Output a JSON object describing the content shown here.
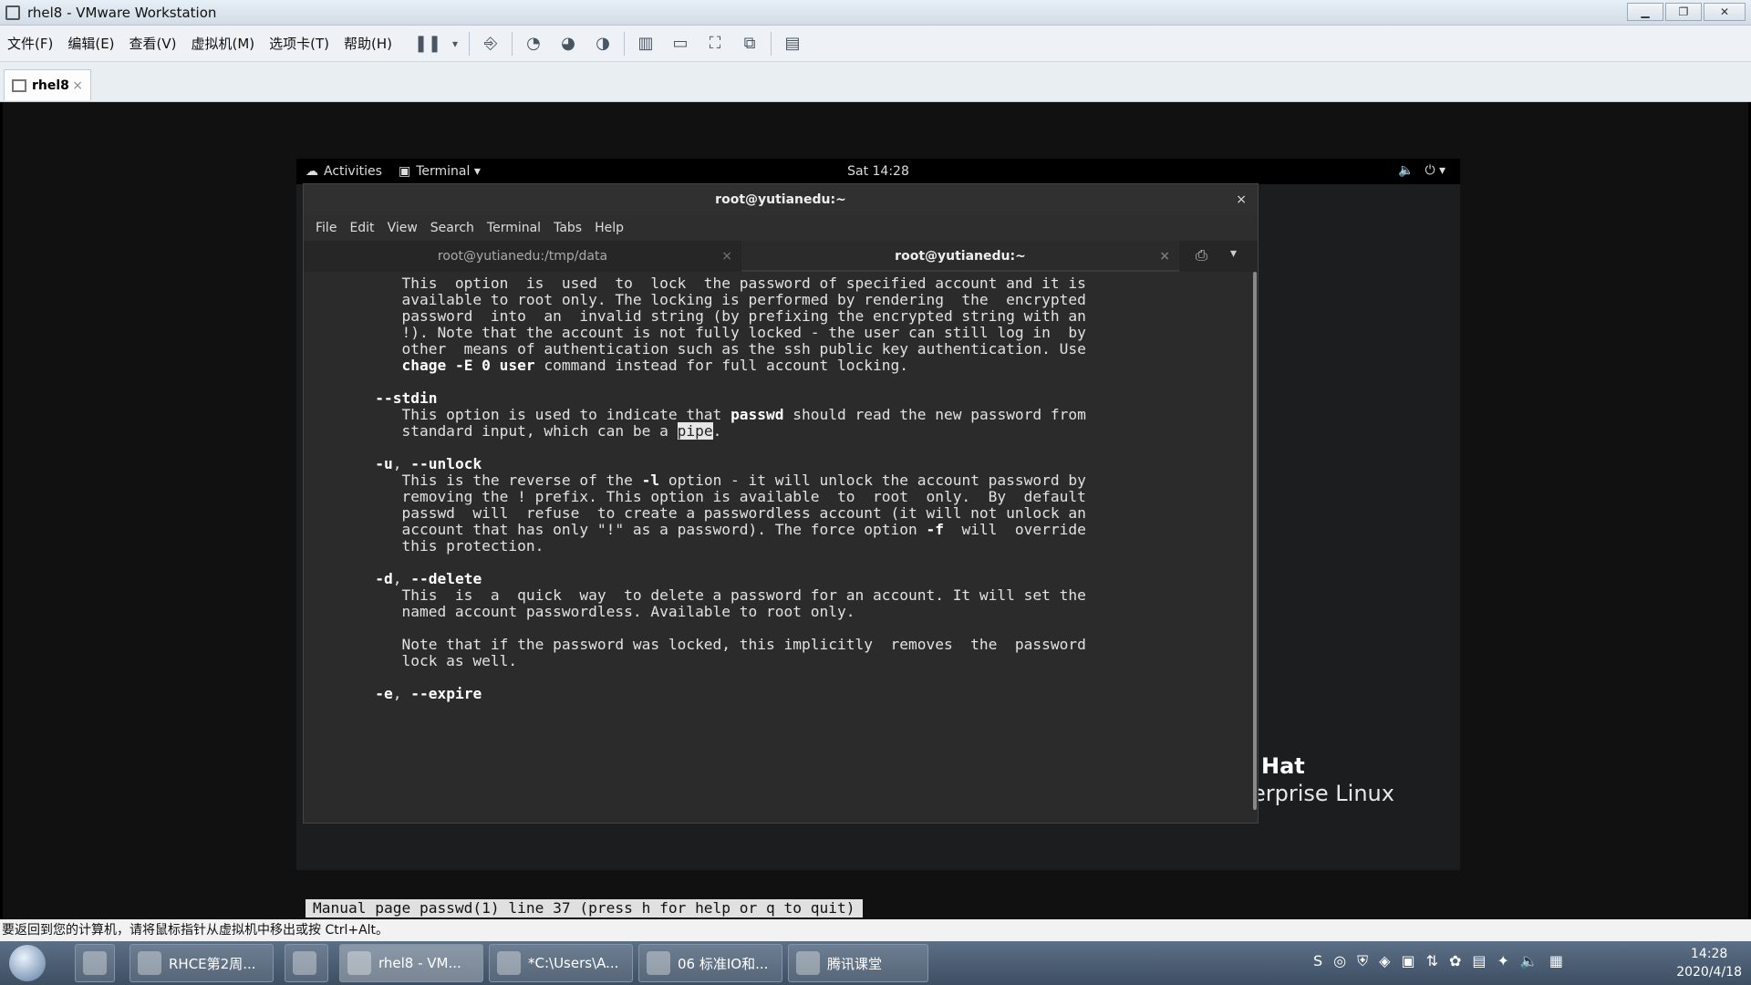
{
  "window": {
    "title": "rhel8 - VMware Workstation"
  },
  "menu": {
    "items": [
      "文件(F)",
      "编辑(E)",
      "查看(V)",
      "虚拟机(M)",
      "选项卡(T)",
      "帮助(H)"
    ]
  },
  "library_tab": {
    "label": "rhel8",
    "close": "×"
  },
  "gnome": {
    "activities": "Activities",
    "app_menu": "Terminal ▾",
    "clock": "Sat 14:28",
    "volume_icon": "🔈",
    "power_icon": "⏻ ▾"
  },
  "terminal": {
    "title": "root@yutianedu:~",
    "close": "×",
    "menu": [
      "File",
      "Edit",
      "View",
      "Search",
      "Terminal",
      "Tabs",
      "Help"
    ],
    "tabs": [
      {
        "label": "root@yutianedu:/tmp/data",
        "close": "×"
      },
      {
        "label": "root@yutianedu:~",
        "close": "×"
      }
    ],
    "status": "Manual page passwd(1) line 37 (press h for help or q to quit)",
    "lines": [
      {
        "segments": [
          {
            "t": "          This  option  is  used  to  lock  the password of specified account and it is"
          }
        ]
      },
      {
        "segments": [
          {
            "t": "          available to root only. The locking is performed by rendering  the  encrypted"
          }
        ]
      },
      {
        "segments": [
          {
            "t": "          password  into  an  invalid string (by prefixing the encrypted string with an"
          }
        ]
      },
      {
        "segments": [
          {
            "t": "          !). Note that the account is not fully locked - the user can still log in  by"
          }
        ]
      },
      {
        "segments": [
          {
            "t": "          other  means of authentication such as the ssh public key authentication. Use"
          }
        ]
      },
      {
        "segments": [
          {
            "t": "          "
          },
          {
            "t": "chage -E 0 user",
            "b": true
          },
          {
            "t": " command instead for full account locking."
          }
        ]
      },
      {
        "segments": [
          {
            "t": ""
          }
        ]
      },
      {
        "segments": [
          {
            "t": "       "
          },
          {
            "t": "--stdin",
            "b": true
          }
        ]
      },
      {
        "segments": [
          {
            "t": "          This option is used to indicate that "
          },
          {
            "t": "passwd",
            "b": true
          },
          {
            "t": " should read the new password from"
          }
        ]
      },
      {
        "segments": [
          {
            "t": "          standard input, which can be a "
          },
          {
            "t": "pipe",
            "hl": true
          },
          {
            "t": "."
          }
        ]
      },
      {
        "segments": [
          {
            "t": ""
          }
        ]
      },
      {
        "segments": [
          {
            "t": "       "
          },
          {
            "t": "-u",
            "b": true
          },
          {
            "t": ", "
          },
          {
            "t": "--unlock",
            "b": true
          }
        ]
      },
      {
        "segments": [
          {
            "t": "          This is the reverse of the "
          },
          {
            "t": "-l",
            "b": true
          },
          {
            "t": " option - it will unlock the account password by"
          }
        ]
      },
      {
        "segments": [
          {
            "t": "          removing the ! prefix. This option is available  to  root  only.  By  default"
          }
        ]
      },
      {
        "segments": [
          {
            "t": "          passwd  will  refuse  to create a passwordless account (it will not unlock an"
          }
        ]
      },
      {
        "segments": [
          {
            "t": "          account that has only \"!\" as a password). The force option "
          },
          {
            "t": "-f",
            "b": true
          },
          {
            "t": "  will  override"
          }
        ]
      },
      {
        "segments": [
          {
            "t": "          this protection."
          }
        ]
      },
      {
        "segments": [
          {
            "t": ""
          }
        ]
      },
      {
        "segments": [
          {
            "t": "       "
          },
          {
            "t": "-d",
            "b": true
          },
          {
            "t": ", "
          },
          {
            "t": "--delete",
            "b": true
          }
        ]
      },
      {
        "segments": [
          {
            "t": "          This  is  a  quick  way  to delete a password for an account. It will set the"
          }
        ]
      },
      {
        "segments": [
          {
            "t": "          named account passwordless. Available to root only."
          }
        ]
      },
      {
        "segments": [
          {
            "t": ""
          }
        ]
      },
      {
        "segments": [
          {
            "t": "          Note that if the password was locked, this implicitly  removes  the  password"
          }
        ]
      },
      {
        "segments": [
          {
            "t": "          lock as well."
          }
        ]
      },
      {
        "segments": [
          {
            "t": ""
          }
        ]
      },
      {
        "segments": [
          {
            "t": "       "
          },
          {
            "t": "-e",
            "b": true
          },
          {
            "t": ", "
          },
          {
            "t": "--expire",
            "b": true
          }
        ]
      }
    ]
  },
  "desktop": {
    "logo_line1": "Hat",
    "logo_line2": "erprise Linux"
  },
  "hint": "要返回到您的计算机，请将鼠标指针从虚拟机中移出或按 Ctrl+Alt。",
  "taskbar": {
    "buttons": [
      {
        "label": "RHCE第2周..."
      },
      {
        "label": "rhel8 - VM..."
      },
      {
        "label": "*C:\\Users\\A..."
      },
      {
        "label": "06 标准IO和..."
      },
      {
        "label": "腾讯课堂"
      }
    ],
    "time": "14:28",
    "date": "2020/4/18"
  },
  "colors": {
    "terminal_bg": "#2b2b2b",
    "gnome_bar": "#000000",
    "taskbar": "#4a5c72"
  }
}
